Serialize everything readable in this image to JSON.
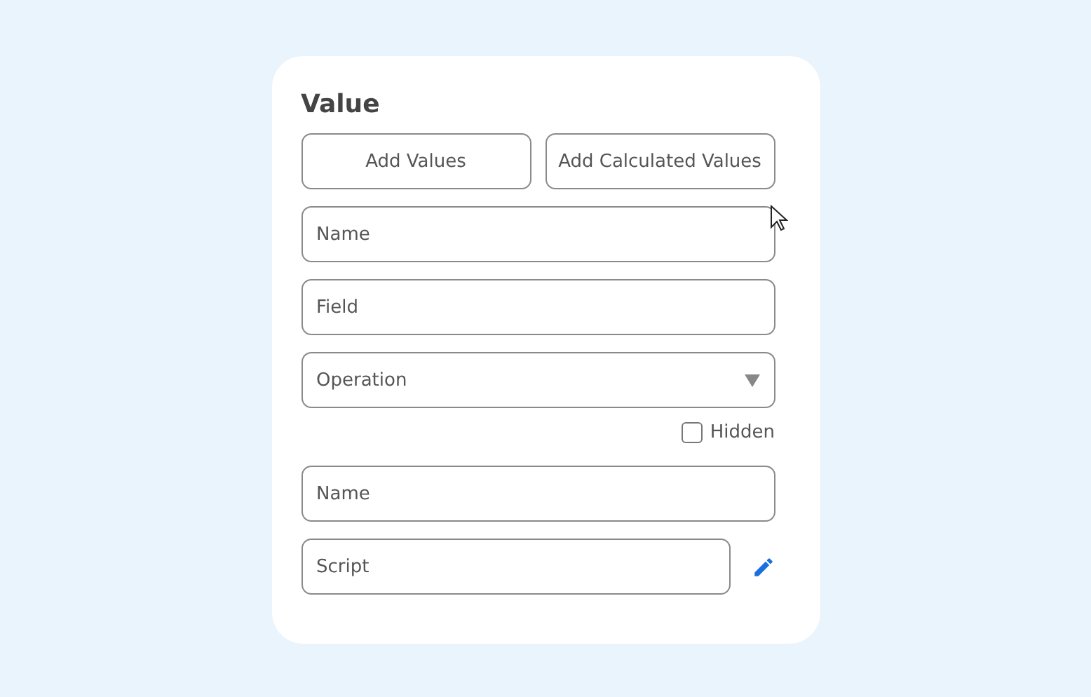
{
  "title": "Value",
  "buttons": [
    "Add Values",
    "Add Calculated Values"
  ],
  "fields": [
    {
      "kind": "input",
      "placeholder": "Name"
    },
    {
      "kind": "input",
      "placeholder": "Field"
    },
    {
      "kind": "select",
      "placeholder": "Operation"
    }
  ],
  "hidden": {
    "label": "Hidden",
    "checked": false
  },
  "calculated_fields": [
    {
      "kind": "input",
      "placeholder": "Name"
    },
    {
      "kind": "script",
      "placeholder": "Script"
    }
  ]
}
